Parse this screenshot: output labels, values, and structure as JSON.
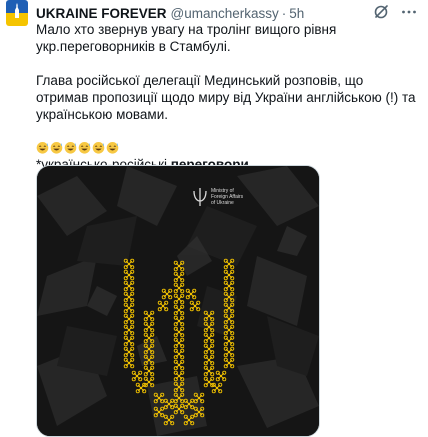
{
  "tweet": {
    "author_name": "UKRAINE FOREVER",
    "handle": "@umancherkassy",
    "separator": "·",
    "time": "5h",
    "line1": "Мало хто звернув увагу на тролінг вищого рівня укр.переговорників в Стамбулі.",
    "line2": "Глава російської делегації Мединський розповів, що отримав пропозиції щодо миру від України англійською (!) та українською мовами.",
    "emoji_count": 6,
    "footer_prefix": "*українсько-російські ",
    "footer_bold": "переговори"
  },
  "media": {
    "ministry_label_line1": "Ministry of",
    "ministry_label_line2": "Foreign Affairs",
    "ministry_label_line3": "of Ukraine"
  },
  "icons": {
    "avatar": "ukraine-flag-avatar",
    "grok": "grok-icon",
    "more": "more-icon",
    "emoji": "sweat-smile-emoji"
  },
  "colors": {
    "accent_yellow": "#f2c200",
    "flag_blue": "#1f5fb5",
    "flag_yellow": "#f5c400"
  }
}
